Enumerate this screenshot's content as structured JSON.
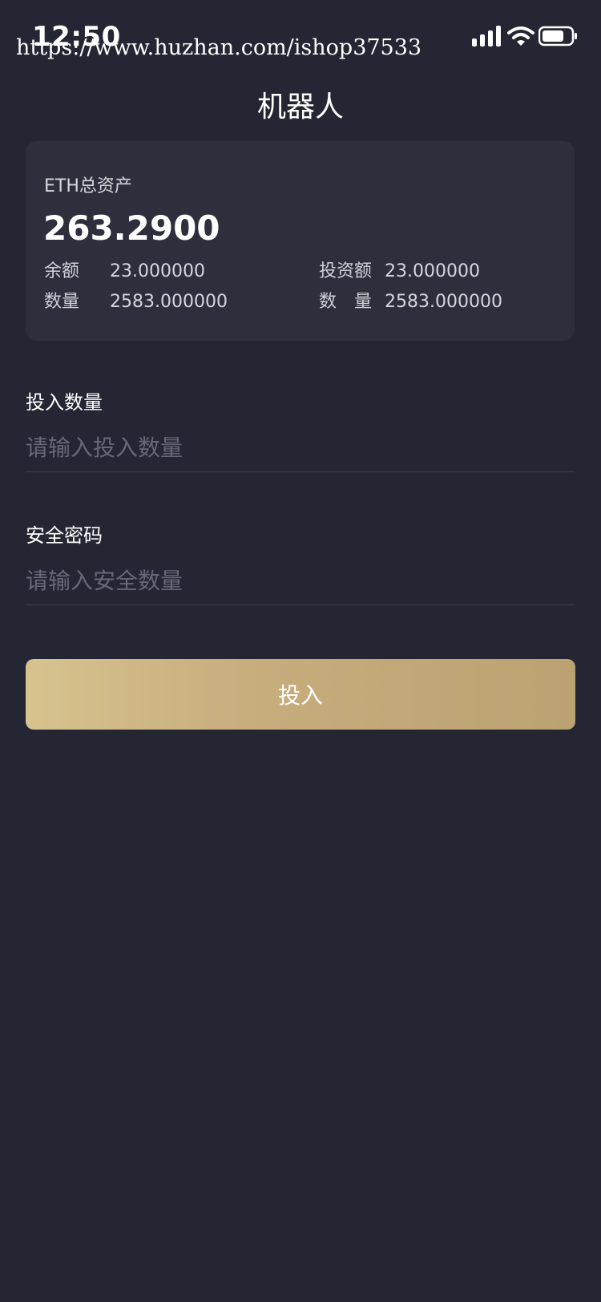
{
  "status_bar": {
    "time": "12:50",
    "watermark": "https://www.huzhan.com/ishop37533"
  },
  "header": {
    "title": "机器人"
  },
  "asset_card": {
    "label": "ETH总资产",
    "total": "263.2900",
    "stats": [
      {
        "key": "余额",
        "value": "23.000000"
      },
      {
        "key": "投资额",
        "value": "23.000000"
      },
      {
        "key": "数量",
        "value": "2583.000000"
      },
      {
        "key": "数　量",
        "value": "2583.000000"
      }
    ]
  },
  "form": {
    "amount": {
      "label": "投入数量",
      "placeholder": "请输入投入数量",
      "value": ""
    },
    "password": {
      "label": "安全密码",
      "placeholder": "请输入安全数量",
      "value": ""
    },
    "submit_label": "投入"
  },
  "colors": {
    "background": "#252633",
    "card": "#2d2f3d",
    "button_gradient_start": "#d6c38e",
    "button_gradient_end": "#bba271"
  }
}
